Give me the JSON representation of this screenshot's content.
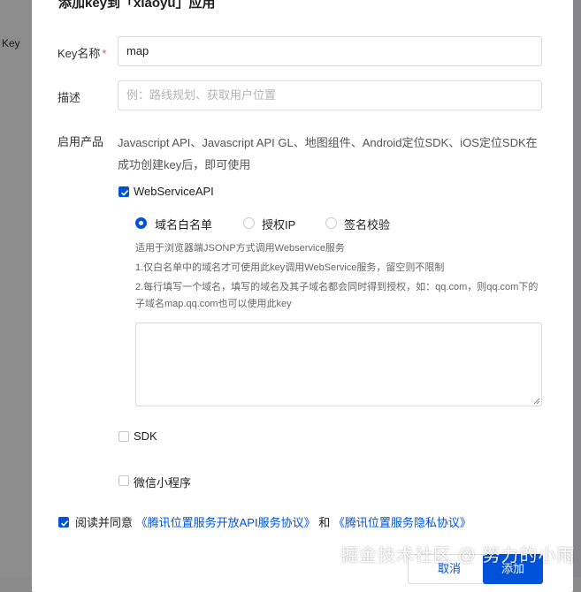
{
  "background": {
    "left_label": "Key"
  },
  "dialog": {
    "title": "添加key到「xiaoyu」应用",
    "key_name": {
      "label": "Key名称",
      "required_mark": "*",
      "value": "map"
    },
    "description": {
      "label": "描述",
      "placeholder": "例：路线规划、获取用户位置"
    },
    "products": {
      "label": "启用产品",
      "text": "Javascript API、Javascript API GL、地图组件、Android定位SDK、iOS定位SDK在成功创建key后，即可使用"
    },
    "webservice": {
      "label": "WebServiceAPI",
      "checked": true,
      "radios": [
        {
          "label": "域名白名单",
          "selected": true
        },
        {
          "label": "授权IP",
          "selected": false
        },
        {
          "label": "签名校验",
          "selected": false
        }
      ],
      "hint_line1": "适用于浏览器端JSONP方式调用Webservice服务",
      "hint_line2": "1.仅白名单中的域名才可使用此key调用WebService服务，留空则不限制",
      "hint_line3": "2.每行填写一个域名，填写的域名及其子域名都会同时得到授权，如：qq.com，则qq.com下的子域名map.qq.com也可以使用此key",
      "textarea_value": ""
    },
    "sdk": {
      "label": "SDK",
      "checked": false
    },
    "mini_program": {
      "label": "微信小程序",
      "checked": false
    },
    "agreement": {
      "checked": true,
      "prefix": "阅读并同意",
      "link1": "《腾讯位置服务开放API服务协议》",
      "and": "和",
      "link2": "《腾讯位置服务隐私协议》"
    },
    "buttons": {
      "cancel": "取消",
      "add": "添加"
    }
  },
  "watermark": "掘金技术社区 @ 努力的小雨",
  "colors": {
    "accent": "#0052d9",
    "required": "#e34d59"
  }
}
